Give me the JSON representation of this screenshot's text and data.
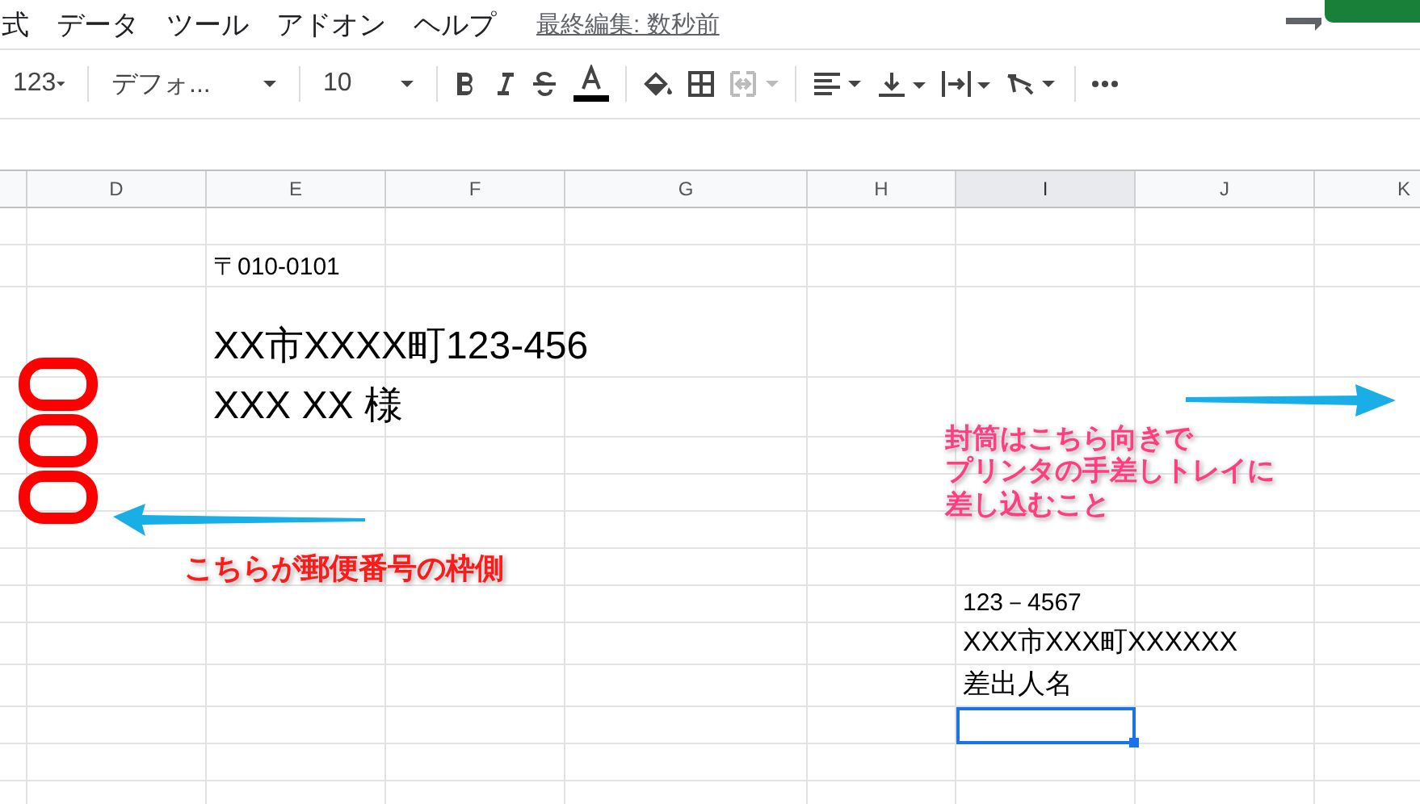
{
  "menu": [
    "式",
    "データ",
    "ツール",
    "アドオン",
    "ヘルプ"
  ],
  "last_edit": "最終編集: 数秒前",
  "toolbar": [
    {
      "kind": "format",
      "label": "123"
    },
    {
      "kind": "font",
      "label": "デフォ..."
    },
    {
      "kind": "size",
      "label": "10"
    }
  ],
  "columns": [
    {
      "label": "D",
      "selected": false
    },
    {
      "label": "E",
      "selected": false
    },
    {
      "label": "F",
      "selected": false
    },
    {
      "label": "G",
      "selected": false
    },
    {
      "label": "H",
      "selected": false
    },
    {
      "label": "I",
      "selected": true
    },
    {
      "label": "J",
      "selected": false
    },
    {
      "label": "K",
      "selected": false
    }
  ],
  "recipient": {
    "postal_code": "〒010-0101",
    "address": "XX市XXXX町123-456",
    "name": "XXX XX 様"
  },
  "sender": {
    "postal_code": "123－4567",
    "address": "XXX市XXX町XXXXXX",
    "name": "差出人名"
  },
  "cursor_cell": {
    "selected": true
  },
  "notes": [
    {
      "lines": [
        "こちらが郵便番号の枠側"
      ],
      "color": "#ff1a1a"
    },
    {
      "lines": [
        "封筒はこちら向きで",
        "プリンタの手差しトレイに",
        "差し込むこと"
      ],
      "color": "#ff3d7f"
    }
  ]
}
